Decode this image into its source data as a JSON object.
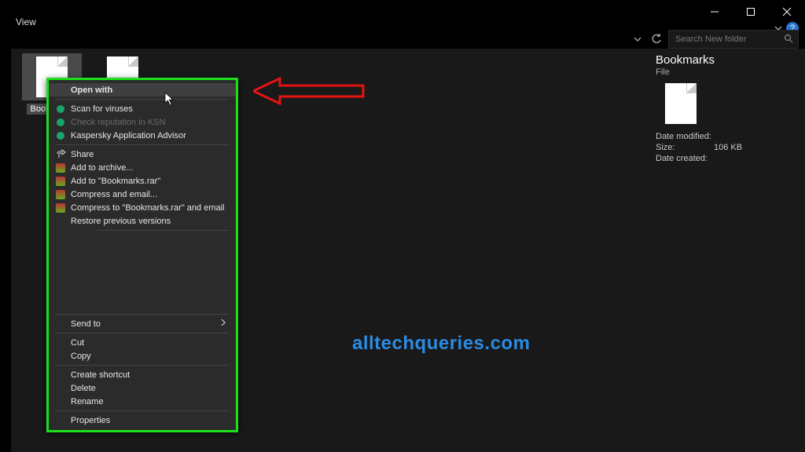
{
  "menubar": {
    "view": "View"
  },
  "window_controls": {
    "help_badge": "?"
  },
  "search": {
    "placeholder": "Search New folder"
  },
  "files": [
    {
      "name": "Bookmarks",
      "selected": true
    },
    {
      "name": "",
      "selected": false
    }
  ],
  "details": {
    "title": "Bookmarks",
    "type": "File",
    "date_modified_label": "Date modified:",
    "date_modified_value": "",
    "size_label": "Size:",
    "size_value": "106 KB",
    "date_created_label": "Date created:",
    "date_created_value": ""
  },
  "context_menu": {
    "open_with": "Open with",
    "scan_viruses": "Scan for viruses",
    "check_reputation": "Check reputation in KSN",
    "kaspersky_advisor": "Kaspersky Application Advisor",
    "share": "Share",
    "add_archive": "Add to archive...",
    "add_bookmarks_rar": "Add to \"Bookmarks.rar\"",
    "compress_email": "Compress and email...",
    "compress_bookmarks_email": "Compress to \"Bookmarks.rar\" and email",
    "restore_prev": "Restore previous versions",
    "send_to": "Send to",
    "cut": "Cut",
    "copy": "Copy",
    "create_shortcut": "Create shortcut",
    "delete": "Delete",
    "rename": "Rename",
    "properties": "Properties"
  },
  "watermark": "alltechqueries.com"
}
